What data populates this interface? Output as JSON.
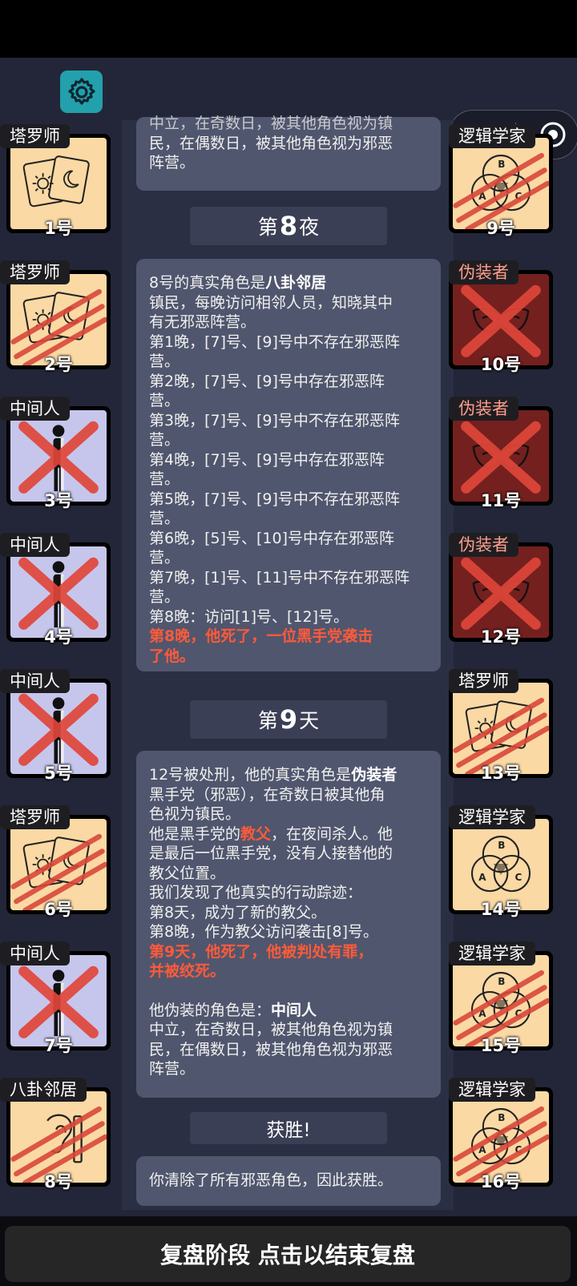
{
  "header": {
    "settings_icon": "gear-icon",
    "menu_icon": "more-dots-icon",
    "close_icon": "target-close-icon"
  },
  "log": {
    "card0": {
      "line1": "中立，在奇数日，被其他角色视为镇",
      "line2": "民，在偶数日，被其他角色视为邪恶",
      "line3": "阵营。"
    },
    "night8": {
      "prefix": "第",
      "num": "8",
      "suffix": "夜"
    },
    "card1": {
      "l1a": "8号的真实角色是",
      "l1b": "八卦邻居",
      "lines": [
        "镇民，每晚访问相邻人员，知晓其中",
        "有无邪恶阵营。",
        "第1晚，[7]号、[9]号中不存在邪恶阵",
        "营。",
        "第2晚，[7]号、[9]号中存在邪恶阵",
        "营。",
        "第3晚，[7]号、[9]号中不存在邪恶阵",
        "营。",
        "第4晚，[7]号、[9]号中存在邪恶阵",
        "营。",
        "第5晚，[7]号、[9]号中不存在邪恶阵",
        "营。",
        "第6晚，[5]号、[10]号中存在邪恶阵",
        "营。",
        "第7晚，[1]号、[11]号中不存在邪恶阵",
        "营。",
        "第8晚：访问[1]号、[12]号。"
      ],
      "red1": "第8晚，他死了，一位黑手党袭击",
      "red2": "了他。"
    },
    "day9": {
      "prefix": "第",
      "num": "9",
      "suffix": "天"
    },
    "card2": {
      "l1a": "12号被处刑，他的真实角色是",
      "l1b": "伪装者",
      "l2": "黑手党（邪恶），在奇数日被其他角",
      "l3": "色视为镇民。",
      "l4a": "他是黑手党的",
      "l4b": "教父",
      "l4c": "，在夜间杀人。他",
      "l5": "是最后一位黑手党，没有人接替他的",
      "l6": "教父位置。",
      "l7": "我们发现了他真实的行动踪迹：",
      "l8": "第8天，成为了新的教父。",
      "l9": "第8晚，作为教父访问袭击[8]号。",
      "red1": "第9天，他死了，他被判处有罪，",
      "red2": "并被绞死。",
      "l10a": "他伪装的角色是：",
      "l10b": "中间人",
      "l11": "中立，在奇数日，被其他角色视为镇",
      "l12": "民，在偶数日，被其他角色视为邪恶",
      "l13": "阵营。"
    },
    "victory": {
      "label": "获胜!"
    },
    "card3": {
      "text": "你清除了所有邪恶角色，因此获胜。"
    }
  },
  "players": [
    {
      "role": "塔罗师",
      "num": "1号",
      "icon": "tarot-icon",
      "dead": false,
      "evil": false
    },
    {
      "role": "塔罗师",
      "num": "2号",
      "icon": "tarot-icon",
      "dead": true,
      "evil": false
    },
    {
      "role": "中间人",
      "num": "3号",
      "icon": "middleman-icon",
      "dead": true,
      "evil": false
    },
    {
      "role": "中间人",
      "num": "4号",
      "icon": "middleman-icon",
      "dead": true,
      "evil": false
    },
    {
      "role": "中间人",
      "num": "5号",
      "icon": "middleman-icon",
      "dead": true,
      "evil": false
    },
    {
      "role": "塔罗师",
      "num": "6号",
      "icon": "tarot-icon",
      "dead": true,
      "evil": false
    },
    {
      "role": "中间人",
      "num": "7号",
      "icon": "middleman-icon",
      "dead": true,
      "evil": false
    },
    {
      "role": "八卦邻居",
      "num": "8号",
      "icon": "ear-icon",
      "dead": true,
      "evil": false
    },
    {
      "role": "逻辑学家",
      "num": "9号",
      "icon": "venn-icon",
      "dead": true,
      "evil": false
    },
    {
      "role": "伪装者",
      "num": "10号",
      "icon": "mask-icon",
      "dead": true,
      "evil": true
    },
    {
      "role": "伪装者",
      "num": "11号",
      "icon": "mask-icon",
      "dead": true,
      "evil": true
    },
    {
      "role": "伪装者",
      "num": "12号",
      "icon": "mask-icon",
      "dead": true,
      "evil": true
    },
    {
      "role": "塔罗师",
      "num": "13号",
      "icon": "tarot-icon",
      "dead": true,
      "evil": false
    },
    {
      "role": "逻辑学家",
      "num": "14号",
      "icon": "venn-icon",
      "dead": false,
      "evil": false
    },
    {
      "role": "逻辑学家",
      "num": "15号",
      "icon": "venn-icon",
      "dead": true,
      "evil": false
    },
    {
      "role": "逻辑学家",
      "num": "16号",
      "icon": "venn-icon",
      "dead": true,
      "evil": false
    }
  ],
  "footer": {
    "label": "复盘阶段 点击以结束复盘"
  },
  "colors": {
    "tarot_bg": "#fbd9a4",
    "middleman_bg": "#c6c6ec",
    "mask_bg": "#74201f",
    "red": "#ff5a3a"
  }
}
